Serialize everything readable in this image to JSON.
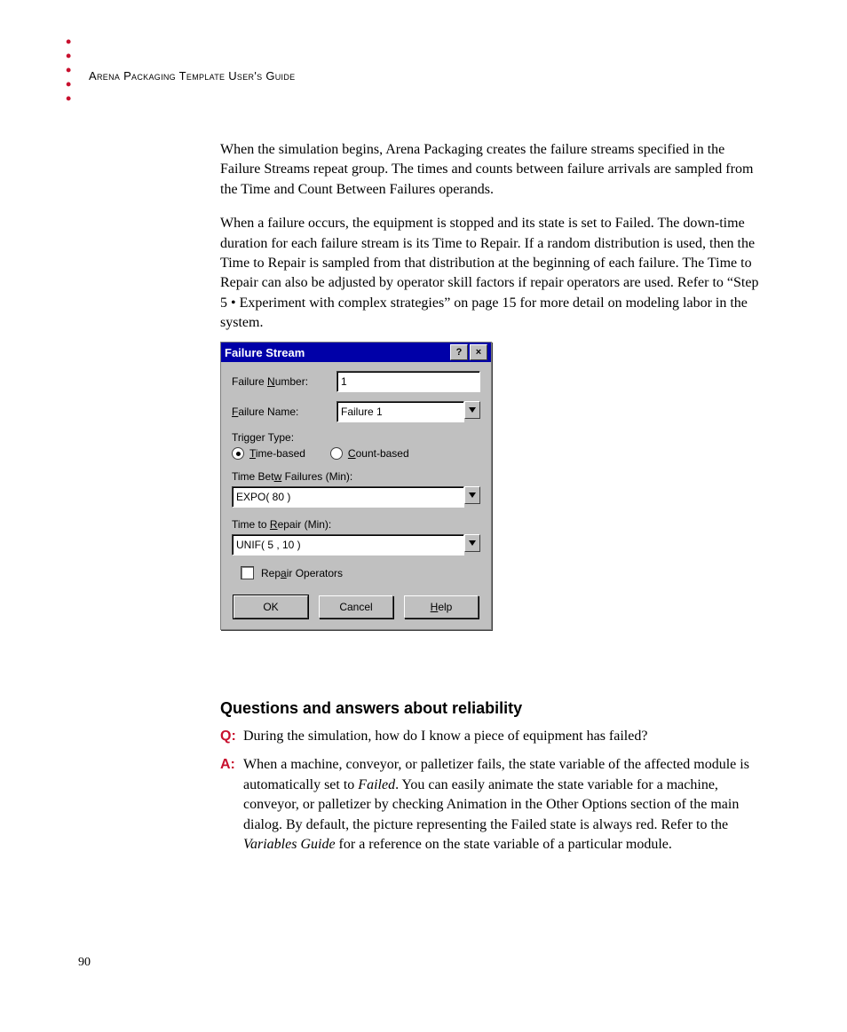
{
  "header": {
    "guide_title": "Arena Packaging Template User's Guide"
  },
  "paragraphs": {
    "p1": "When the simulation begins, Arena Packaging creates the failure streams specified in the Failure Streams repeat group. The times and counts between failure arrivals are sampled from the Time and Count Between Failures operands.",
    "p2": "When a failure occurs, the equipment is stopped and its state is set to Failed. The down-time duration for each failure stream is its Time to Repair. If a random distribution is used, then the Time to Repair is sampled from that distribution at the beginning of each failure. The Time to Repair can also be adjusted by operator skill factors if repair operators are used. Refer to “Step 5 • Experiment with complex strategies” on page 15 for more detail on modeling labor in the system."
  },
  "dialog": {
    "title": "Failure Stream",
    "failure_number_label": "Failure Number:",
    "failure_number_value": "1",
    "failure_name_label": "Failure Name:",
    "failure_name_value": "Failure 1",
    "trigger_type_label": "Trigger Type:",
    "radio_time": "Time-based",
    "radio_count": "Count-based",
    "time_between_label": "Time Betw Failures (Min):",
    "time_between_value": "EXPO( 80 )",
    "time_repair_label": "Time to Repair (Min):",
    "time_repair_value": "UNIF( 5 , 10 )",
    "repair_ops_label": "Repair Operators",
    "ok": "OK",
    "cancel": "Cancel",
    "help": "Help"
  },
  "qa": {
    "heading": "Questions and answers about reliability",
    "q_label": "Q:",
    "a_label": "A:",
    "q_text": "During the simulation, how do I know a piece of equipment has failed?",
    "a_pre": "When a machine, conveyor, or palletizer fails, the state variable of the affected module is automatically set to ",
    "a_failed": "Failed",
    "a_mid": ". You can easily animate the state variable for a machine, conveyor, or palletizer by checking Animation in the Other Options section of the main dialog. By default, the picture representing the Failed state is always red. Refer to the ",
    "a_varguide": "Variables Guide",
    "a_post": " for a reference on the state variable of a particular module."
  },
  "page_number": "90"
}
